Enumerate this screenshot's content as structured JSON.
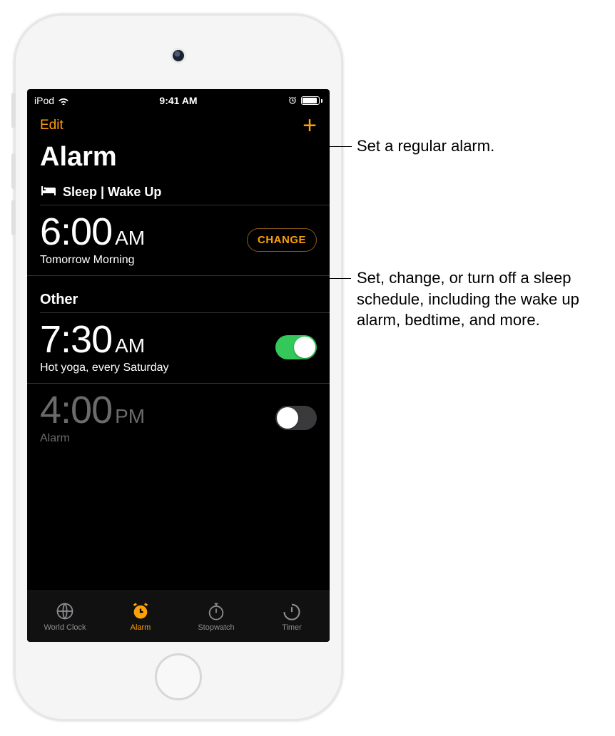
{
  "status": {
    "carrier": "iPod",
    "time": "9:41 AM"
  },
  "nav": {
    "edit": "Edit",
    "add_glyph": "+"
  },
  "title": "Alarm",
  "sleep_section": {
    "label": "Sleep | Wake Up",
    "time": "6:00",
    "ampm": "AM",
    "subtitle": "Tomorrow Morning",
    "change_label": "CHANGE"
  },
  "other_section": {
    "label": "Other",
    "alarms": [
      {
        "time": "7:30",
        "ampm": "AM",
        "subtitle": "Hot yoga, every Saturday",
        "on": true
      },
      {
        "time": "4:00",
        "ampm": "PM",
        "subtitle": "Alarm",
        "on": false
      }
    ]
  },
  "tabs": {
    "world": "World Clock",
    "alarm": "Alarm",
    "stopwatch": "Stopwatch",
    "timer": "Timer"
  },
  "callouts": {
    "add": "Set a regular alarm.",
    "change": "Set, change, or turn off a sleep schedule, including the wake up alarm, bedtime, and more."
  }
}
